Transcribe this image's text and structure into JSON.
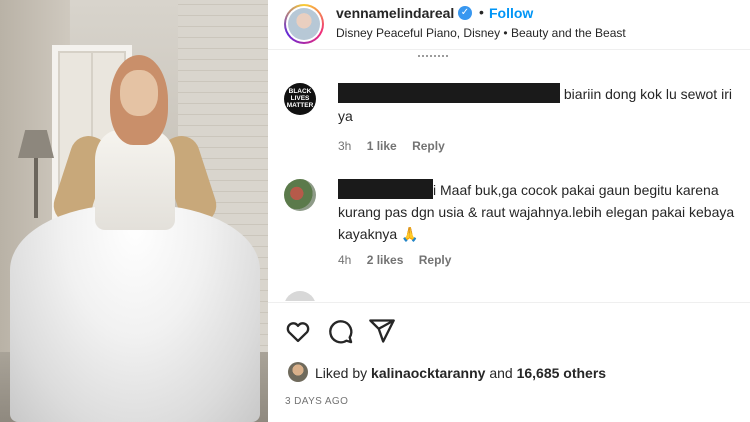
{
  "post": {
    "username": "vennamelindareal",
    "follow_label": "Follow",
    "separator": "•",
    "audio": "Disney Peaceful Piano, Disney • Beauty and the Beast"
  },
  "comments": [
    {
      "avatar_text": "BLACK LIVES MATTER",
      "text_before": "",
      "text_after": " biariin dong kok lu sewot iri ya",
      "time": "3h",
      "likes": "1 like",
      "reply": "Reply"
    },
    {
      "avatar_text": "",
      "text_before": "",
      "text_after": "i Maaf buk,ga cocok pakai gaun begitu karena kurang pas dgn usia & raut wajahnya.lebih elegan pakai kebaya kayaknya 🙏",
      "time": "4h",
      "likes": "2 likes",
      "reply": "Reply"
    }
  ],
  "likes": {
    "prefix": "Liked by ",
    "user": "kalinaocktaranny",
    "middle": " and ",
    "others": "16,685 others"
  },
  "date": "3 DAYS AGO",
  "icons": {
    "like": "heart-icon",
    "comment": "comment-icon",
    "share": "share-icon",
    "verified": "verified-badge-icon"
  },
  "colors": {
    "accent": "#0095f6",
    "verified": "#3897f0",
    "meta": "#737373"
  }
}
